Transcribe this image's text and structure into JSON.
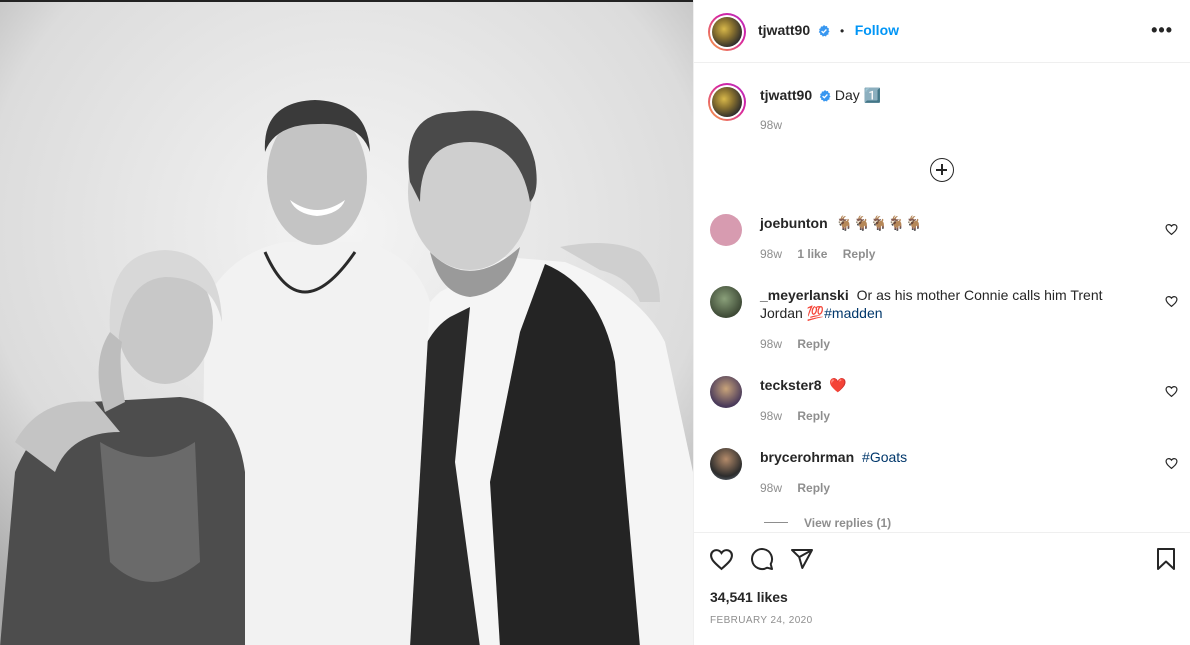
{
  "post": {
    "author": "tjwatt90",
    "follow_label": "Follow",
    "more_icon": "more-icon",
    "caption_text": "Day",
    "caption_emoji": "1️⃣",
    "caption_time": "98w",
    "likes": "34,541 likes",
    "date": "FEBRUARY 24, 2020"
  },
  "comments": [
    {
      "user": "joebunton",
      "text": "🐐🐐🐐🐐🐐",
      "time": "98w",
      "likes": "1 like",
      "reply": "Reply"
    },
    {
      "user": "_meyerlanski",
      "text": "Or as his mother Connie calls him Trent Jordan 💯",
      "hashtag": "#madden",
      "time": "98w",
      "reply": "Reply"
    },
    {
      "user": "teckster8",
      "text": "❤️",
      "time": "98w",
      "reply": "Reply"
    },
    {
      "user": "brycerohrman",
      "hashtag": "#Goats",
      "time": "98w",
      "reply": "Reply"
    }
  ],
  "view_replies": "View replies (1)",
  "colors": {
    "accent": "#0095f6",
    "hashtag": "#00376b",
    "muted": "#8e8e8e",
    "verified": "#3897f0"
  },
  "icons": [
    "verified-badge-icon",
    "heart-icon",
    "comment-icon",
    "share-icon",
    "bookmark-icon",
    "add-circle-icon"
  ]
}
